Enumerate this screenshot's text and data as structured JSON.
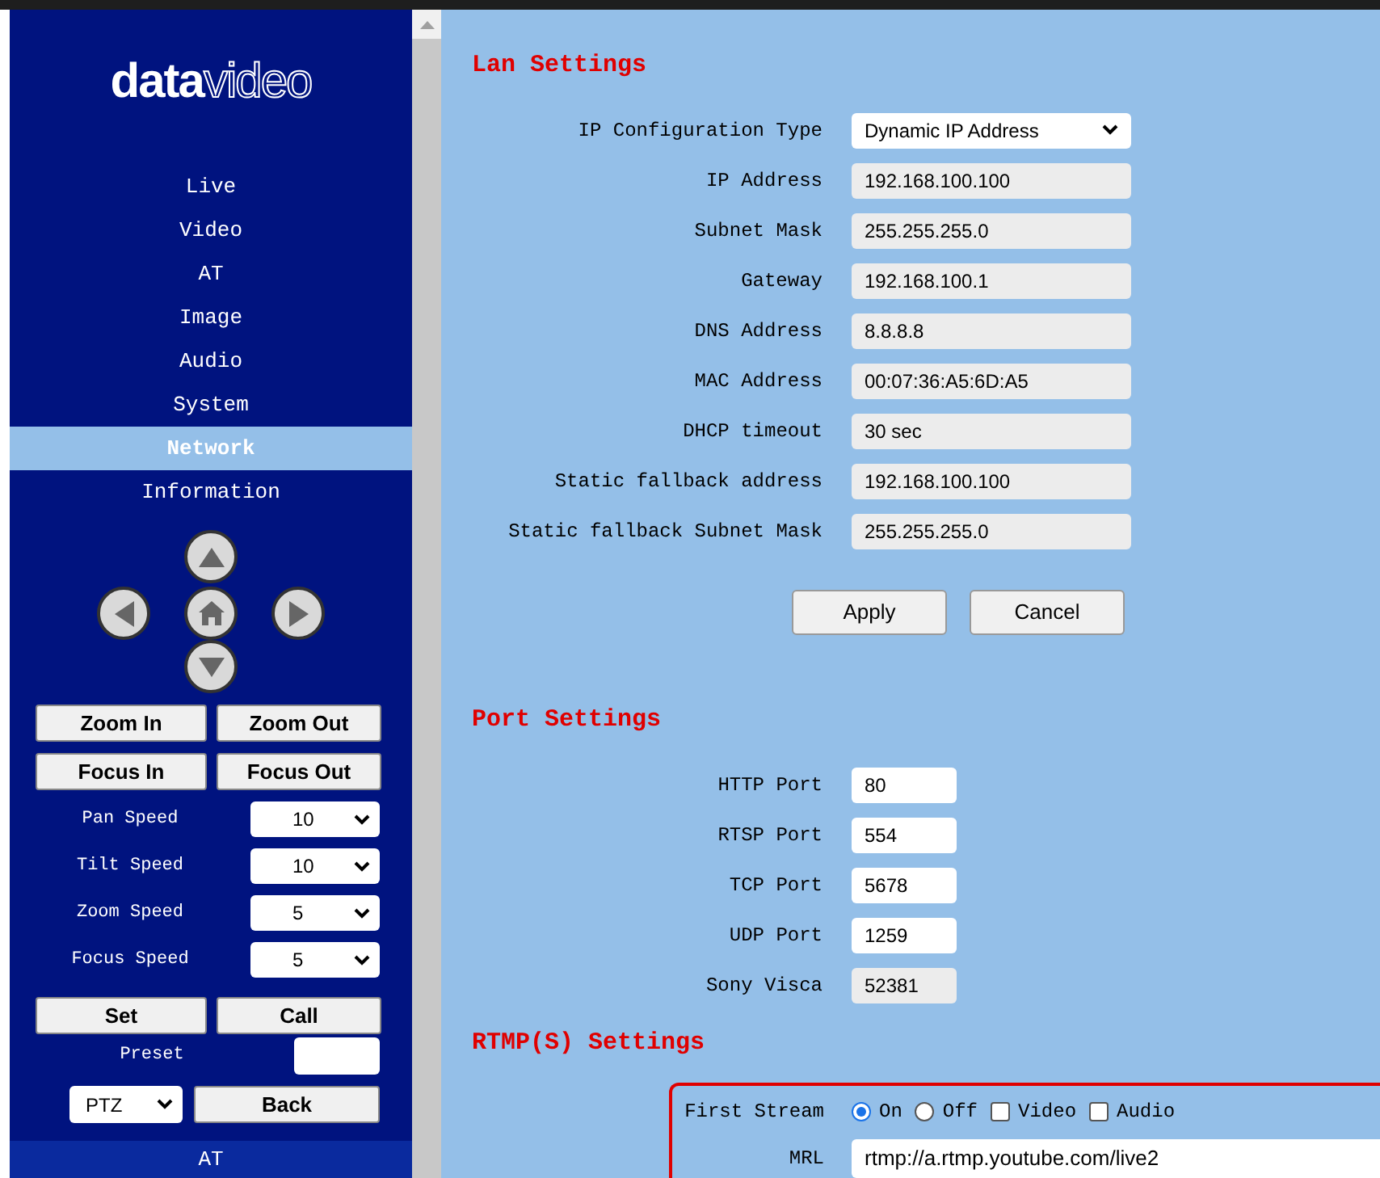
{
  "sidebar": {
    "logo": {
      "bold": "data",
      "light": "video"
    },
    "nav": [
      {
        "label": "Live",
        "selected": false
      },
      {
        "label": "Video",
        "selected": false
      },
      {
        "label": "AT",
        "selected": false
      },
      {
        "label": "Image",
        "selected": false
      },
      {
        "label": "Audio",
        "selected": false
      },
      {
        "label": "System",
        "selected": false
      },
      {
        "label": "Network",
        "selected": true
      },
      {
        "label": "Information",
        "selected": false
      }
    ],
    "lens_buttons": [
      [
        "Zoom In",
        "Zoom Out"
      ],
      [
        "Focus In",
        "Focus Out"
      ]
    ],
    "speeds": [
      {
        "label": "Pan Speed",
        "value": "10"
      },
      {
        "label": "Tilt Speed",
        "value": "10"
      },
      {
        "label": "Zoom Speed",
        "value": "5"
      },
      {
        "label": "Focus Speed",
        "value": "5"
      }
    ],
    "preset_buttons": [
      "Set",
      "Call"
    ],
    "preset_label": "Preset",
    "mode": "PTZ",
    "back": "Back",
    "footer": "AT"
  },
  "lan": {
    "title": "Lan Settings",
    "rows": [
      {
        "label": "IP Configuration Type",
        "kind": "select",
        "value": "Dynamic IP Address"
      },
      {
        "label": "IP Address",
        "kind": "readonly",
        "value": "192.168.100.100"
      },
      {
        "label": "Subnet Mask",
        "kind": "readonly",
        "value": "255.255.255.0"
      },
      {
        "label": "Gateway",
        "kind": "readonly",
        "value": "192.168.100.1"
      },
      {
        "label": "DNS Address",
        "kind": "readonly",
        "value": "8.8.8.8"
      },
      {
        "label": "MAC Address",
        "kind": "readonly",
        "value": "00:07:36:A5:6D:A5"
      },
      {
        "label": "DHCP timeout",
        "kind": "readonly",
        "value": "30 sec"
      },
      {
        "label": "Static fallback address",
        "kind": "readonly",
        "value": "192.168.100.100"
      },
      {
        "label": "Static fallback Subnet Mask",
        "kind": "readonly",
        "value": "255.255.255.0"
      }
    ],
    "buttons": [
      "Apply",
      "Cancel"
    ]
  },
  "port": {
    "title": "Port Settings",
    "rows": [
      {
        "label": "HTTP Port",
        "value": "80",
        "disabled": false
      },
      {
        "label": "RTSP Port",
        "value": "554",
        "disabled": false
      },
      {
        "label": "TCP Port",
        "value": "5678",
        "disabled": false
      },
      {
        "label": "UDP Port",
        "value": "1259",
        "disabled": false
      },
      {
        "label": "Sony Visca",
        "value": "52381",
        "disabled": true
      }
    ]
  },
  "rtmp": {
    "title": "RTMP(S) Settings",
    "stream_label": "First Stream",
    "options": [
      {
        "kind": "radio",
        "label": "On",
        "checked": true
      },
      {
        "kind": "radio",
        "label": "Off",
        "checked": false
      },
      {
        "kind": "checkbox",
        "label": "Video",
        "checked": false
      },
      {
        "kind": "checkbox",
        "label": "Audio",
        "checked": false
      }
    ],
    "mrl_label": "MRL",
    "mrl": "rtmp://a.rtmp.youtube.com/live2"
  }
}
